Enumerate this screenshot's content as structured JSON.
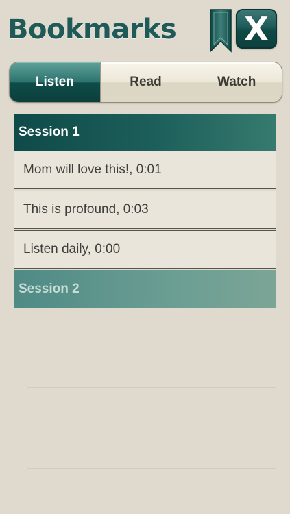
{
  "header": {
    "title": "Bookmarks",
    "close_label": "X"
  },
  "tabs": [
    {
      "label": "Listen",
      "active": true
    },
    {
      "label": "Read",
      "active": false
    },
    {
      "label": "Watch",
      "active": false
    }
  ],
  "sessions": [
    {
      "title": "Session 1",
      "expanded": true,
      "items": [
        {
          "label": "Mom will love this!, 0:01"
        },
        {
          "label": "This is profound, 0:03"
        },
        {
          "label": "Listen daily, 0:00"
        }
      ]
    },
    {
      "title": "Session 2",
      "expanded": false,
      "items": []
    }
  ],
  "colors": {
    "background": "#dfdacd",
    "accent": "#1f5a58",
    "active_tab": "#0f4c49"
  },
  "icons": {
    "bookmark": "bookmark-ribbon-icon",
    "close": "close-x-icon"
  }
}
